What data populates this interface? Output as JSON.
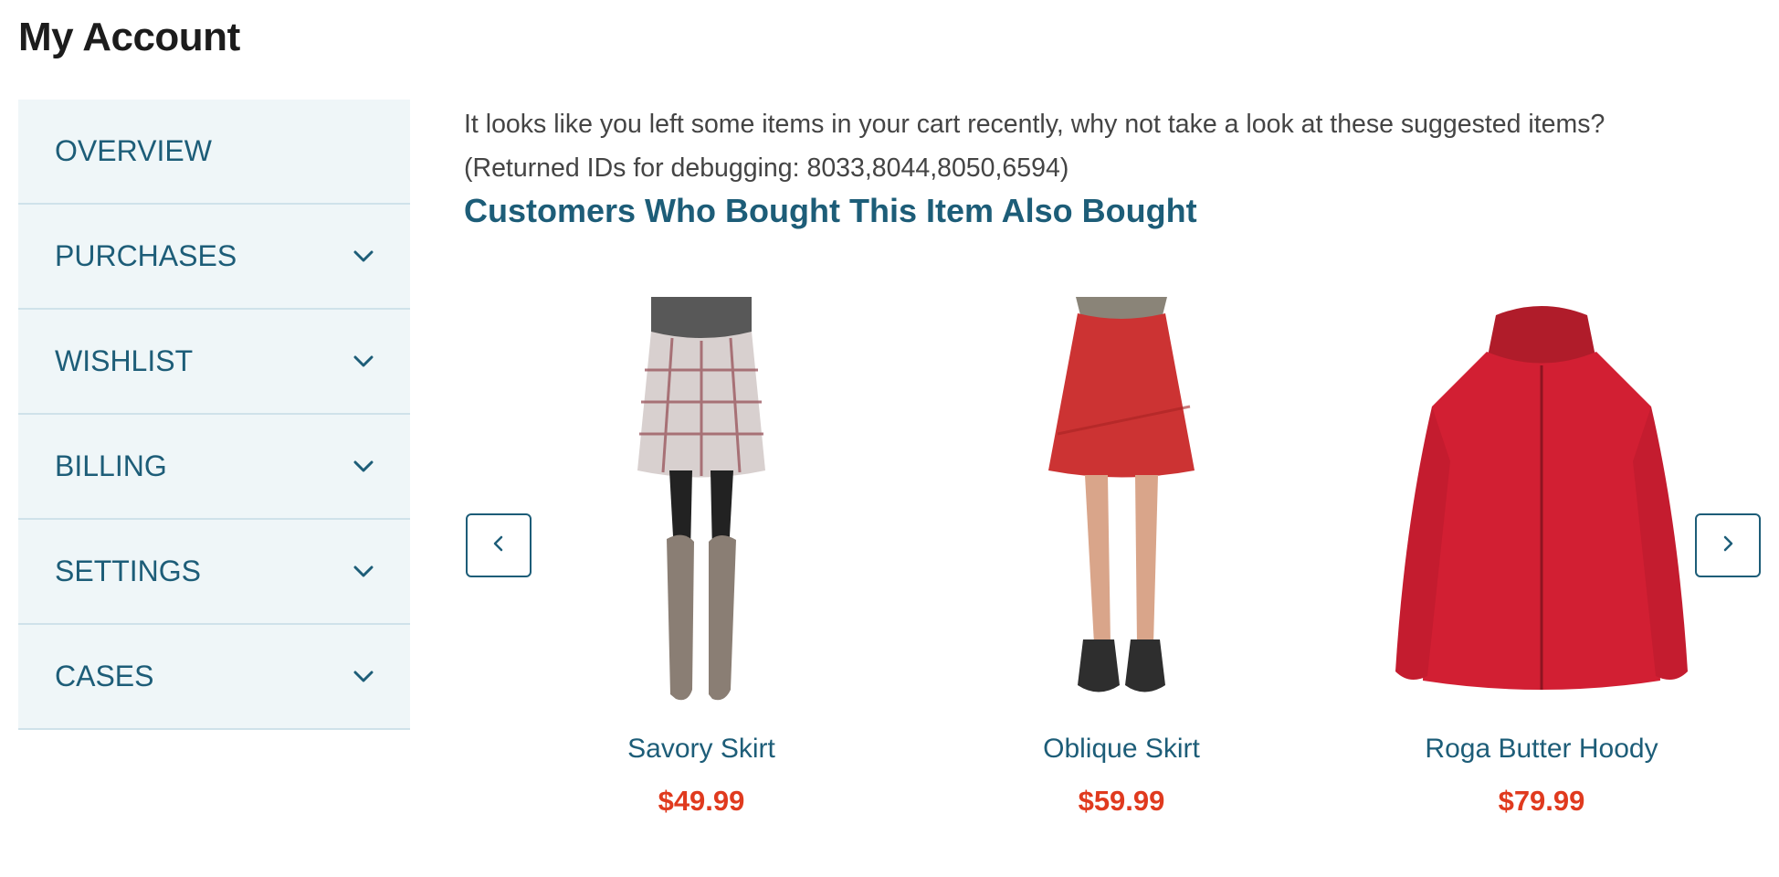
{
  "page": {
    "title": "My Account"
  },
  "sidebar": {
    "items": [
      {
        "label": "OVERVIEW",
        "has_chevron": false
      },
      {
        "label": "PURCHASES",
        "has_chevron": true
      },
      {
        "label": "WISHLIST",
        "has_chevron": true
      },
      {
        "label": "BILLING",
        "has_chevron": true
      },
      {
        "label": "SETTINGS",
        "has_chevron": true
      },
      {
        "label": "CASES",
        "has_chevron": true
      }
    ]
  },
  "main": {
    "intro": "It looks like you left some items in your cart recently, why not take a look at these suggested items?",
    "debug": "(Returned IDs for debugging: 8033,8044,8050,6594)",
    "section_title": "Customers Who Bought This Item Also Bought"
  },
  "carousel": {
    "prev_icon": "chevron-left-icon",
    "next_icon": "chevron-right-icon",
    "products": [
      {
        "name": "Savory Skirt",
        "price": "$49.99",
        "image": "plaid-skirt-with-boots"
      },
      {
        "name": "Oblique Skirt",
        "price": "$59.99",
        "image": "red-skirt-with-clogs"
      },
      {
        "name": "Roga Butter Hoody",
        "price": "$79.99",
        "image": "red-zip-hoody"
      }
    ]
  },
  "colors": {
    "accent": "#1d5d78",
    "price": "#e03a1e",
    "sidebar_bg": "#eff6f8",
    "divider": "#cfe2ea"
  }
}
